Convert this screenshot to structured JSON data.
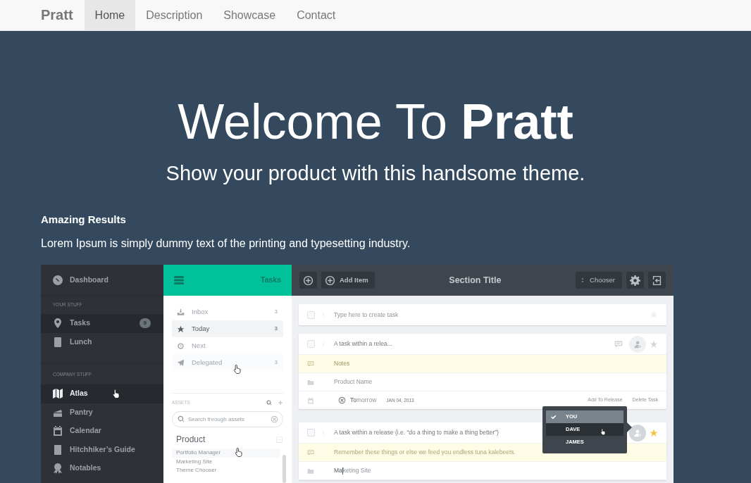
{
  "navbar": {
    "brand": "Pratt",
    "links": [
      {
        "label": "Home",
        "selected": true
      },
      {
        "label": "Description",
        "selected": false
      },
      {
        "label": "Showcase",
        "selected": false
      },
      {
        "label": "Contact",
        "selected": false
      }
    ]
  },
  "hero": {
    "title": "Welcome To **Pratt**",
    "subtitle": "Show your product with this handsome theme."
  },
  "feature": {
    "heading": "Amazing Results",
    "text": "Lorem Ipsum is simply dummy text of the printing and typesetting industry."
  },
  "app": {
    "sidebar": {
      "home": "Dashboard",
      "sections": [
        {
          "heading": "YOUR STUFF",
          "items": [
            {
              "label": "Tasks",
              "badge": "9",
              "selected": true,
              "pointer": false
            },
            {
              "label": "Lunch",
              "selected": false,
              "pointer": false
            }
          ]
        },
        {
          "heading": "COMPANY STUFF",
          "items": [
            {
              "label": "Atlas",
              "selected": true,
              "pointer": true
            },
            {
              "label": "Pantry",
              "selected": false,
              "pointer": false
            },
            {
              "label": "Calendar",
              "selected": false,
              "pointer": false
            },
            {
              "label": "Hitchhiker’s Guide",
              "selected": false,
              "pointer": false
            },
            {
              "label": "Notables",
              "selected": false,
              "pointer": false
            }
          ]
        }
      ]
    },
    "lists": {
      "title": "Tasks",
      "items": [
        {
          "label": "Inbox",
          "count": "3",
          "selected": false,
          "pointer": false
        },
        {
          "label": "Today",
          "count": "3",
          "selected": true,
          "pointer": false
        },
        {
          "label": "Next",
          "selected": false,
          "pointer": false
        },
        {
          "label": "Delegated",
          "count": "3",
          "selected": false,
          "pointer": true
        }
      ],
      "assets_heading": "ASSETS",
      "search": {
        "placeholder": "Search through assets"
      },
      "group": {
        "title": "Product",
        "items": [
          {
            "label": "Portfolio Manager",
            "pointer": true
          },
          {
            "label": "Marketing Site",
            "pointer": false
          },
          {
            "label": "Theme Chooser",
            "pointer": false
          }
        ]
      }
    },
    "toolbar": {
      "add_label": "Add Item",
      "title": "Section Title",
      "chooser": "Chooser"
    },
    "new_task": {
      "placeholder": "Type here to create task",
      "checked": false
    },
    "tasks": [
      {
        "title": "A task within a relea...",
        "checked": false,
        "starred": false,
        "notes": {
          "placeholder": "Notes"
        },
        "product": {
          "placeholder": "Product Name"
        },
        "due": {
          "typed": "To",
          "hint": "morrow",
          "date": "JAN 04, 2013"
        },
        "actions": [
          "Add To Release",
          "Delete Task"
        ]
      },
      {
        "title": "A task within a release (i.e. “do a thing to make a thing better”)",
        "checked": false,
        "starred": true,
        "notes": {
          "value": "Remember these things or else we feed you endless tuna kalebeets."
        },
        "product": {
          "typed": "Ma",
          "hint": "keting Site"
        },
        "assignee_menu": {
          "options": [
            {
              "label": "YOU",
              "checked": true,
              "selected": false
            },
            {
              "label": "DAVE",
              "checked": false,
              "selected": true
            },
            {
              "label": "JAMES",
              "checked": false,
              "selected": false
            }
          ]
        }
      }
    ]
  }
}
